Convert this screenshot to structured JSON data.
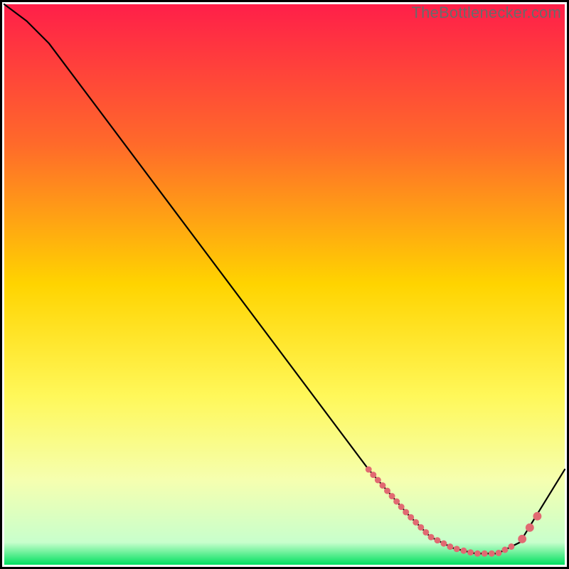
{
  "watermark": "TheBottlenecker.com",
  "chart_data": {
    "type": "line",
    "title": "",
    "xlabel": "",
    "ylabel": "",
    "xlim": [
      0,
      100
    ],
    "ylim": [
      0,
      100
    ],
    "gradient_stops": [
      {
        "offset": 0,
        "color": "#ff1f49"
      },
      {
        "offset": 25,
        "color": "#ff6a2a"
      },
      {
        "offset": 50,
        "color": "#ffd400"
      },
      {
        "offset": 70,
        "color": "#fff85a"
      },
      {
        "offset": 85,
        "color": "#f5ffb0"
      },
      {
        "offset": 96,
        "color": "#c8ffcc"
      },
      {
        "offset": 100,
        "color": "#00e060"
      }
    ],
    "series": [
      {
        "name": "curve",
        "x": [
          0,
          4,
          8,
          65,
          72,
          76,
          80,
          84,
          88,
          92,
          100
        ],
        "y": [
          100,
          97,
          93,
          17,
          9,
          5,
          3,
          2,
          2,
          4,
          17
        ]
      }
    ],
    "dotted_segment": {
      "x": [
        65,
        72,
        76,
        80,
        84,
        88,
        92,
        94,
        96
      ],
      "y": [
        17,
        9,
        5,
        3,
        2,
        2,
        4,
        7,
        10
      ]
    },
    "dot_color": "#e16a72",
    "dot_radius_small": 4.5,
    "dot_radius_large": 6
  }
}
